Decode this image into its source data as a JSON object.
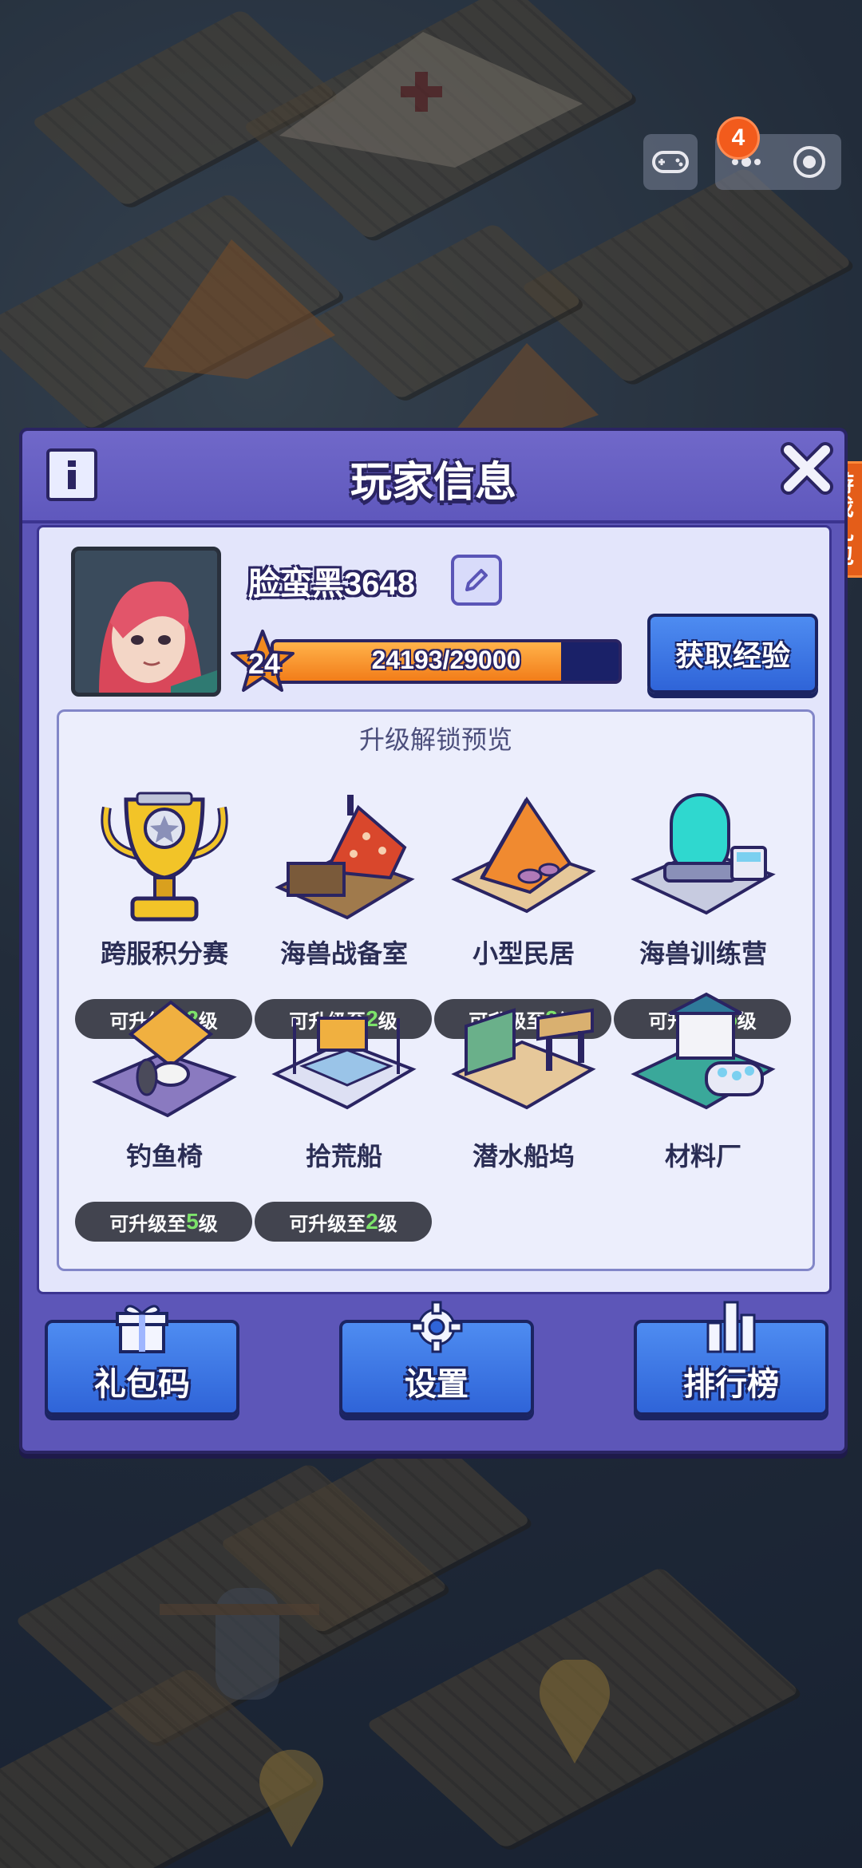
{
  "hud": {
    "notification_count": "4",
    "side_tab_label": "游戏礼包"
  },
  "panel": {
    "title": "玩家信息",
    "player": {
      "name": "脸蛮黑3648",
      "level": "24",
      "xp_text": "24193/29000",
      "xp_progress": 0.834
    },
    "get_xp_label": "获取经验",
    "preview": {
      "title": "升级解锁预览",
      "items": [
        {
          "name": "跨服积分赛",
          "tag_prefix": "可升级至",
          "tag_level": "2",
          "tag_suffix": "级",
          "icon": "trophy-icon"
        },
        {
          "name": "海兽战备室",
          "tag_prefix": "可升级至",
          "tag_level": "2",
          "tag_suffix": "级",
          "icon": "war-room-icon"
        },
        {
          "name": "小型民居",
          "tag_prefix": "可升级至",
          "tag_level": "2",
          "tag_suffix": "级",
          "icon": "tent-house-icon"
        },
        {
          "name": "海兽训练营",
          "tag_prefix": "可升级至",
          "tag_level": "5",
          "tag_suffix": "级",
          "icon": "training-camp-icon"
        },
        {
          "name": "钓鱼椅",
          "tag_prefix": "可升级至",
          "tag_level": "5",
          "tag_suffix": "级",
          "icon": "fishing-chair-icon"
        },
        {
          "name": "拾荒船",
          "tag_prefix": "可升级至",
          "tag_level": "2",
          "tag_suffix": "级",
          "icon": "scavenger-boat-icon"
        },
        {
          "name": "潜水船坞",
          "tag_prefix": "",
          "tag_level": "",
          "tag_suffix": "",
          "icon": "dive-dock-icon"
        },
        {
          "name": "材料厂",
          "tag_prefix": "",
          "tag_level": "",
          "tag_suffix": "",
          "icon": "material-factory-icon"
        }
      ]
    },
    "buttons": {
      "gift_code": "礼包码",
      "settings": "设置",
      "leaderboard": "排行榜"
    }
  },
  "colors": {
    "panel": "#5d56b8",
    "button_blue": "#2f64d8",
    "xp_orange": "#f27d1a",
    "badge_orange": "#f25b1c",
    "level_tag_green": "#7de36b"
  }
}
